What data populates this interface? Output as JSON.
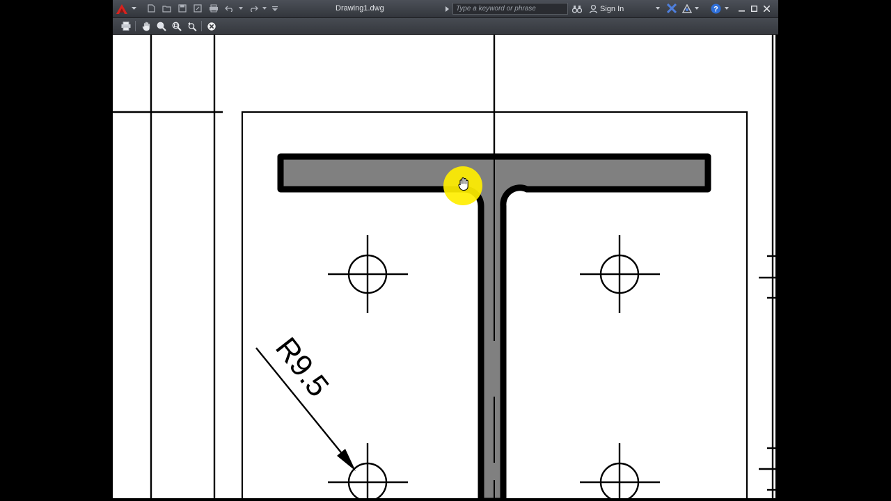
{
  "window": {
    "title": "Drawing1.dwg",
    "app_logo": "autocad-a-logo"
  },
  "quick_access": {
    "icons": [
      "new-icon",
      "open-icon",
      "save-icon",
      "save-as-icon",
      "plot-icon",
      "undo-icon",
      "redo-icon",
      "customize-dropdown-icon"
    ]
  },
  "search": {
    "placeholder": "Type a keyword or phrase"
  },
  "account": {
    "sign_in_label": "Sign In"
  },
  "window_controls": [
    "minimize",
    "maximize",
    "close"
  ],
  "viewer_toolbar": {
    "icons": [
      "print-icon",
      "pan-hand-icon",
      "zoom-realtime-icon",
      "zoom-window-icon",
      "zoom-previous-icon",
      "close-viewer-icon"
    ]
  },
  "drawing": {
    "dimension_text": "R9.5",
    "colors": {
      "paper": "#ffffff",
      "line": "#000000",
      "section_fill": "#808080",
      "cursor_highlight": "#ffee00"
    }
  }
}
